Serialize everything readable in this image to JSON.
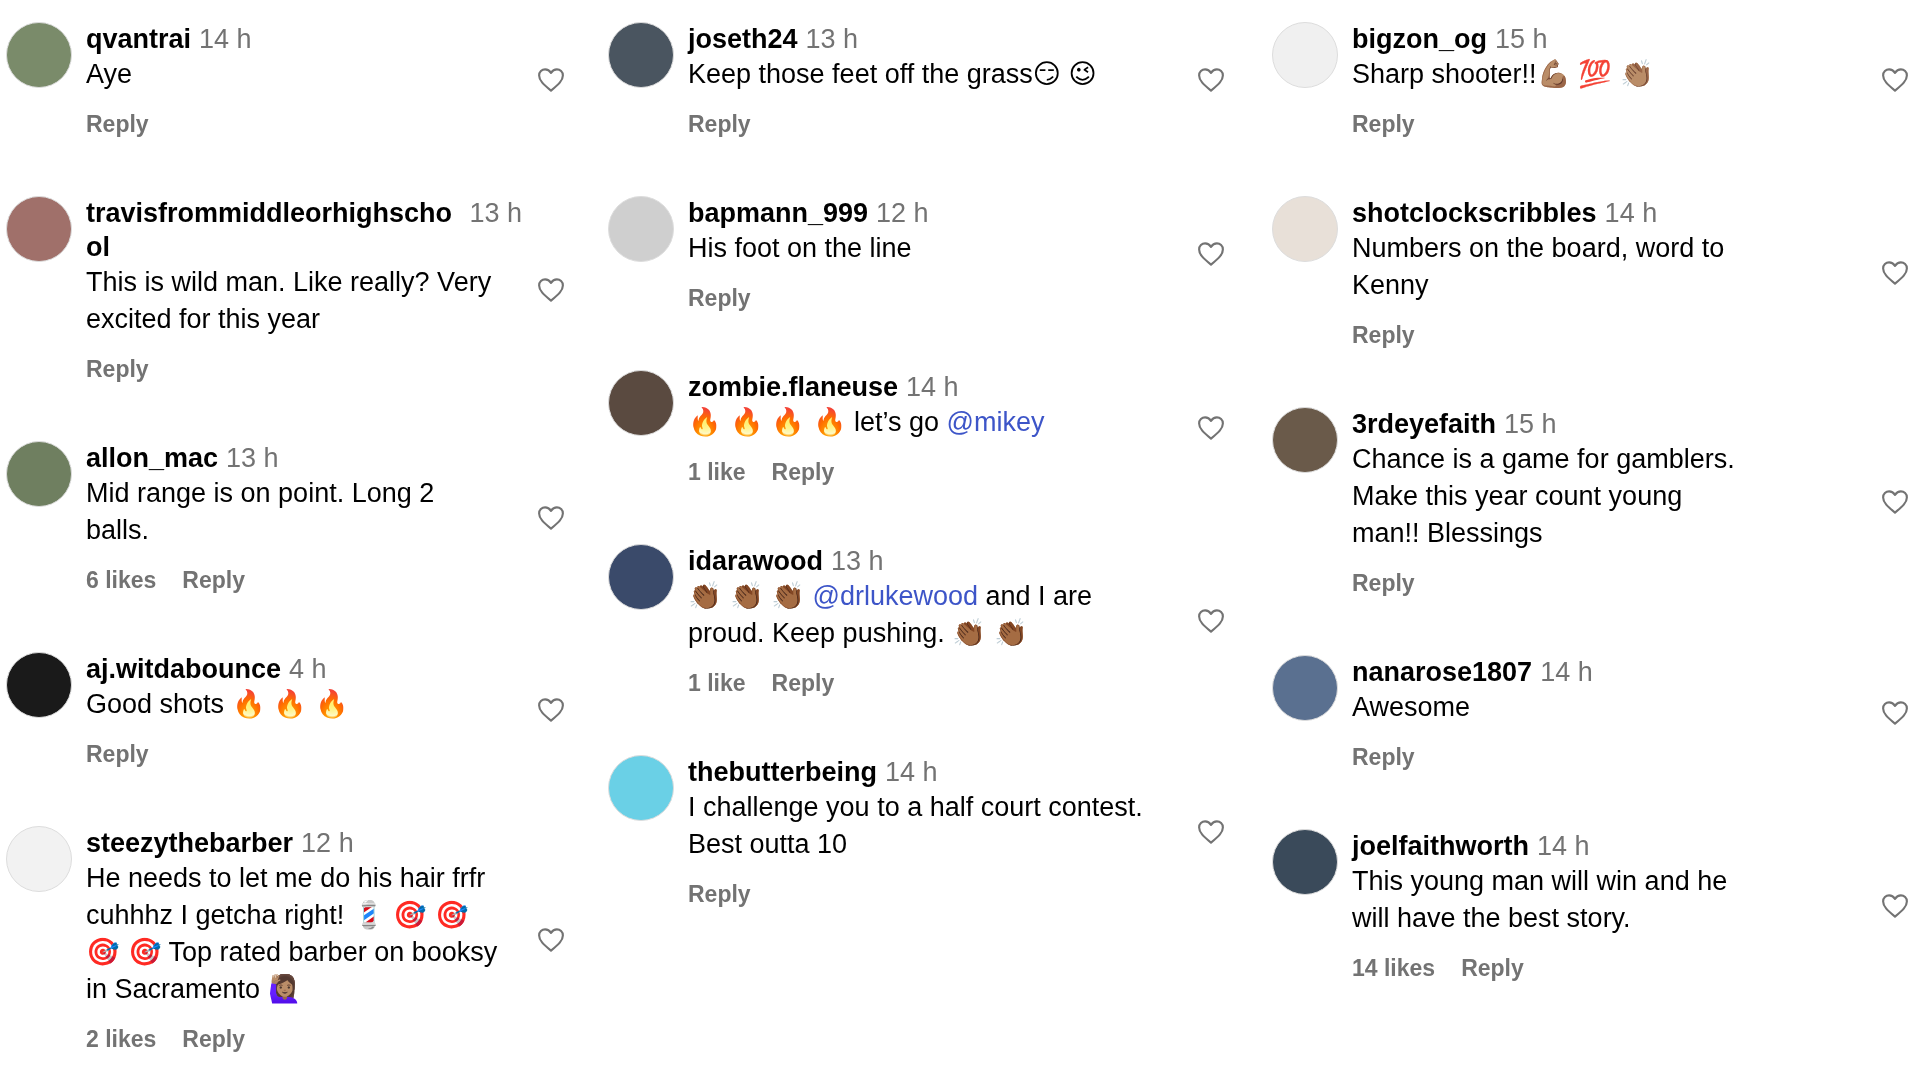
{
  "columns": [
    {
      "comments": [
        {
          "username": "qvantrai",
          "time": "14 h",
          "text": [
            {
              "kind": "plain",
              "text": "Aye"
            }
          ],
          "reply": "Reply"
        },
        {
          "username": "travisfrommiddleorhighschool",
          "time": "13 h",
          "text": [
            {
              "kind": "plain",
              "text": "This is wild man. Like really? Very excited for this year"
            }
          ],
          "reply": "Reply"
        },
        {
          "username": "allon_mac",
          "time": "13 h",
          "text": [
            {
              "kind": "plain",
              "text": "Mid range is on point. Long 2 balls."
            }
          ],
          "likes": "6 likes",
          "reply": "Reply"
        },
        {
          "username": "aj.witdabounce",
          "time": "4 h",
          "text": [
            {
              "kind": "plain",
              "text": "Good shots 🔥 🔥 🔥"
            }
          ],
          "reply": "Reply"
        },
        {
          "username": "steezythebarber",
          "time": "12 h",
          "text": [
            {
              "kind": "plain",
              "text": "He needs to let me do his hair frfr cuhhhz I getcha right! 💈 🎯 🎯 🎯 🎯 Top rated barber on booksy in Sacramento 🙋🏽‍♀️"
            }
          ],
          "likes": "2 likes",
          "reply": "Reply"
        }
      ]
    },
    {
      "comments": [
        {
          "username": "joseth24",
          "time": "13 h",
          "text": [
            {
              "kind": "plain",
              "text": "Keep those feet off the grass😏 😉"
            }
          ],
          "reply": "Reply"
        },
        {
          "username": "bapmann_999",
          "time": "12 h",
          "text": [
            {
              "kind": "plain",
              "text": "His foot on the line"
            }
          ],
          "reply": "Reply"
        },
        {
          "username": "zombie.flaneuse",
          "time": "14 h",
          "text": [
            {
              "kind": "plain",
              "text": "🔥 🔥 🔥 🔥  let’s go "
            },
            {
              "kind": "mention",
              "text": "@mikey"
            }
          ],
          "likes": "1 like",
          "reply": "Reply"
        },
        {
          "username": "idarawood",
          "time": "13 h",
          "text": [
            {
              "kind": "plain",
              "text": "👏🏾 👏🏾 👏🏾 "
            },
            {
              "kind": "mention",
              "text": "@drlukewood"
            },
            {
              "kind": "plain",
              "text": " and I are proud. Keep pushing. 👏🏾 👏🏾"
            }
          ],
          "likes": "1 like",
          "reply": "Reply"
        },
        {
          "username": "thebutterbeing",
          "time": "14 h",
          "text": [
            {
              "kind": "plain",
              "text": "I challenge you to a half court contest. Best outta 10"
            }
          ],
          "reply": "Reply"
        }
      ]
    },
    {
      "comments": [
        {
          "username": "bigzon_og",
          "time": "15 h",
          "text": [
            {
              "kind": "plain",
              "text": "Sharp shooter!!💪🏽 💯 👏🏽"
            }
          ],
          "reply": "Reply"
        },
        {
          "username": "shotclockscribbles",
          "time": "14 h",
          "text": [
            {
              "kind": "plain",
              "text": "Numbers on the board, word to Kenny"
            }
          ],
          "reply": "Reply"
        },
        {
          "username": "3rdeyefaith",
          "time": "15 h",
          "text": [
            {
              "kind": "plain",
              "text": "Chance is a game for gamblers. Make this year count young man!! Blessings"
            }
          ],
          "reply": "Reply"
        },
        {
          "username": "nanarose1807",
          "time": "14 h",
          "text": [
            {
              "kind": "plain",
              "text": "Awesome"
            }
          ],
          "reply": "Reply"
        },
        {
          "username": "joelfaithworth",
          "time": "14 h",
          "text": [
            {
              "kind": "plain",
              "text": "This young man will win and he will have the best story."
            }
          ],
          "likes": "14 likes",
          "reply": "Reply"
        }
      ]
    }
  ]
}
